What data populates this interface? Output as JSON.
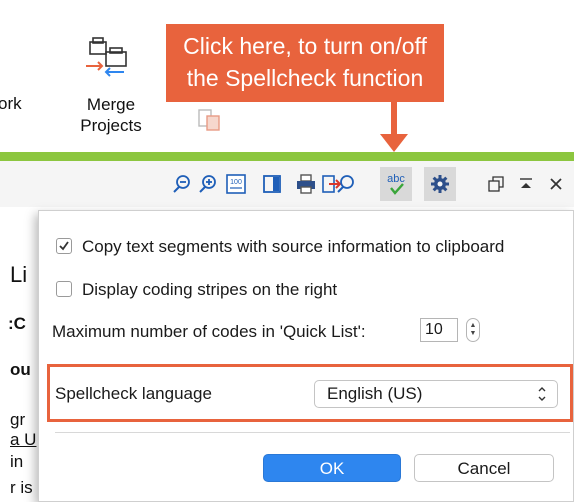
{
  "ribbon": {
    "partial_label": "ork",
    "merge_projects_line1": "Merge",
    "merge_projects_line2": "Projects"
  },
  "callout": {
    "line1": "Click here, to turn on/off",
    "line2": "the Spellcheck function"
  },
  "toolbar": {
    "icons": [
      "zoom-out-icon",
      "zoom-in-icon",
      "zoom-100-icon",
      "panel-toggle-icon",
      "print-icon",
      "export-icon",
      "search-icon",
      "spellcheck-icon",
      "settings-gear-icon",
      "window-restore-icon",
      "collapse-icon",
      "close-icon"
    ],
    "zoom_100_label": "100",
    "spellcheck_label": "abc"
  },
  "document": {
    "fragments": [
      "Li",
      ":C",
      "ou",
      "gr",
      "a U",
      "in",
      "r is"
    ]
  },
  "options": {
    "copy_with_source": {
      "label": "Copy text segments with source information to clipboard",
      "checked": true
    },
    "coding_stripes_right": {
      "label": "Display coding stripes on the right",
      "checked": false
    },
    "quick_list": {
      "label": "Maximum number of codes in 'Quick List':",
      "value": "10"
    },
    "spellcheck_language": {
      "label": "Spellcheck language",
      "value": "English (US)"
    }
  },
  "buttons": {
    "ok": "OK",
    "cancel": "Cancel"
  },
  "colors": {
    "accent_orange": "#e8633d",
    "ribbon_green": "#8cc63f",
    "primary_blue": "#2e86ef"
  }
}
